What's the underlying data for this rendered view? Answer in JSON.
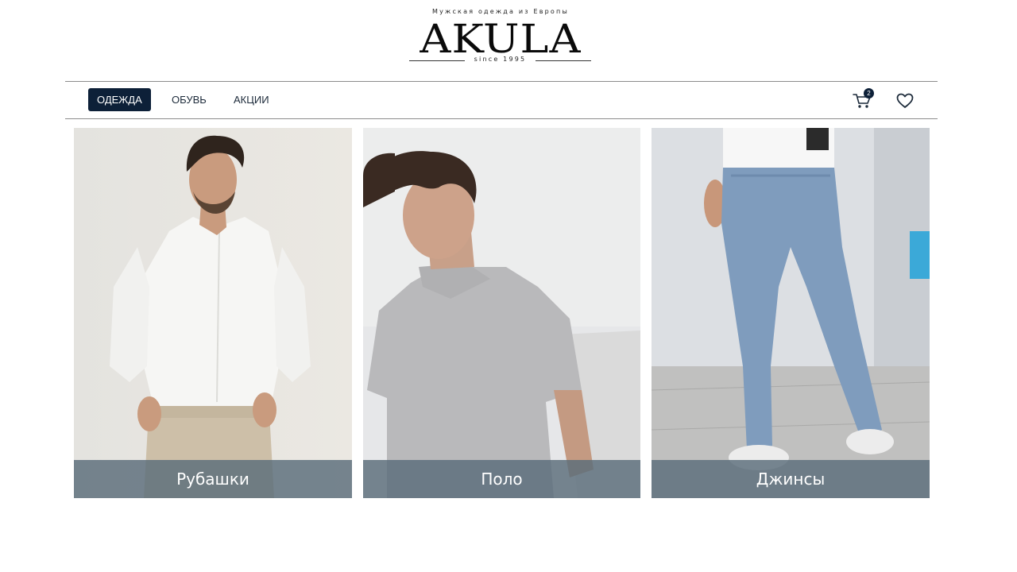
{
  "brand": {
    "tagline": "Мужская одежда из Европы",
    "name": "AKULA",
    "since": "since 1995"
  },
  "nav": {
    "tabs": [
      {
        "label": "ОДЕЖДА",
        "active": true
      },
      {
        "label": "ОБУВЬ",
        "active": false
      },
      {
        "label": "АКЦИИ",
        "active": false
      }
    ],
    "cart_count": "2",
    "cart_icon": "cart-icon",
    "favorites_icon": "heart-icon"
  },
  "categories": [
    {
      "label": "Рубашки"
    },
    {
      "label": "Поло"
    },
    {
      "label": "Джинсы"
    }
  ],
  "colors": {
    "accent": "#0d2038",
    "caption_bg": "#5a6c7a"
  }
}
